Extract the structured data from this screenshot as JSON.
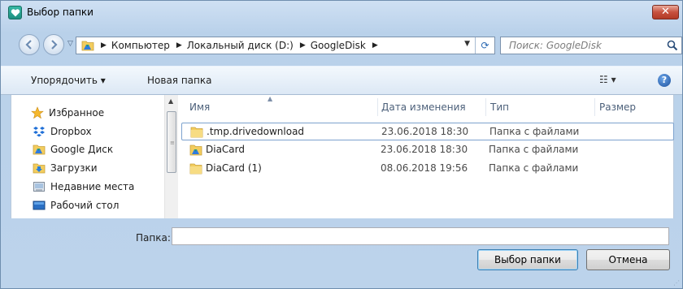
{
  "window": {
    "title": "Выбор папки",
    "close_label": "✕"
  },
  "address": {
    "crumbs": [
      "Компьютер",
      "Локальный диск (D:)",
      "GoogleDisk"
    ],
    "refresh_glyph": "⟳"
  },
  "search": {
    "placeholder": "Поиск: GoogleDisk"
  },
  "toolbar": {
    "organize_label": "Упорядочить ▾",
    "new_folder_label": "Новая папка",
    "view_label": "☷ ▾",
    "help_label": "?"
  },
  "sidebar": {
    "items": [
      {
        "label": "Избранное",
        "icon": "star-icon"
      },
      {
        "label": "Dropbox",
        "icon": "dropbox-icon"
      },
      {
        "label": "Google Диск",
        "icon": "google-drive-folder-icon"
      },
      {
        "label": "Загрузки",
        "icon": "downloads-folder-icon"
      },
      {
        "label": "Недавние места",
        "icon": "recent-places-icon"
      },
      {
        "label": "Рабочий стол",
        "icon": "desktop-icon"
      }
    ]
  },
  "files": {
    "columns": {
      "name": "Имя",
      "date": "Дата изменения",
      "type": "Тип",
      "size": "Размер"
    },
    "rows": [
      {
        "name": ".tmp.drivedownload",
        "date": "23.06.2018 18:30",
        "type": "Папка с файлами"
      },
      {
        "name": "DiaCard",
        "date": "23.06.2018 18:30",
        "type": "Папка с файлами"
      },
      {
        "name": "DiaCard (1)",
        "date": "08.06.2018 19:56",
        "type": "Папка с файлами"
      }
    ]
  },
  "footer": {
    "folder_label": "Папка:",
    "folder_value": "",
    "select_button": "Выбор папки",
    "cancel_button": "Отмена"
  },
  "colors": {
    "title_bg": "#c4d9ef",
    "close_red": "#c7503d",
    "accent_blue": "#2c6ab3",
    "folder_yellow": "#f3cd5e"
  }
}
